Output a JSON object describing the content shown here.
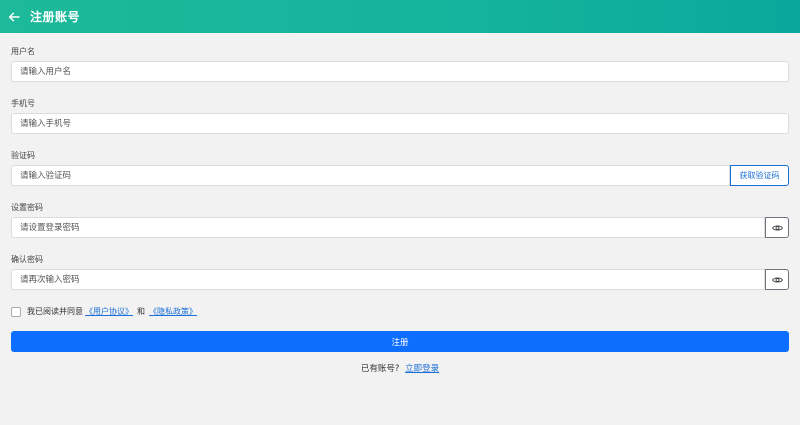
{
  "header": {
    "title": "注册账号",
    "back_icon": "arrow-left-icon"
  },
  "form": {
    "username": {
      "label": "用户名",
      "placeholder": "请输入用户名",
      "value": ""
    },
    "phone": {
      "label": "手机号",
      "placeholder": "请输入手机号",
      "value": ""
    },
    "code": {
      "label": "验证码",
      "placeholder": "请输入验证码",
      "value": "",
      "button_label": "获取验证码"
    },
    "password": {
      "label": "设置密码",
      "placeholder": "请设置登录密码",
      "value": "",
      "toggle_icon": "eye-icon"
    },
    "confirm_password": {
      "label": "确认密码",
      "placeholder": "请再次输入密码",
      "value": "",
      "toggle_icon": "eye-icon"
    }
  },
  "agreement": {
    "checked": false,
    "prefix": "我已阅读并同意",
    "user_agreement": "《用户协议》",
    "and": "和",
    "privacy_policy": "《隐私政策》"
  },
  "submit": {
    "label": "注册"
  },
  "login": {
    "prompt": "已有账号?",
    "link_label": "立即登录"
  },
  "colors": {
    "header_start": "#1db99a",
    "header_end": "#0aa89c",
    "primary": "#0d6efd",
    "link": "#1a6fd6",
    "background": "#f2f2f2"
  }
}
